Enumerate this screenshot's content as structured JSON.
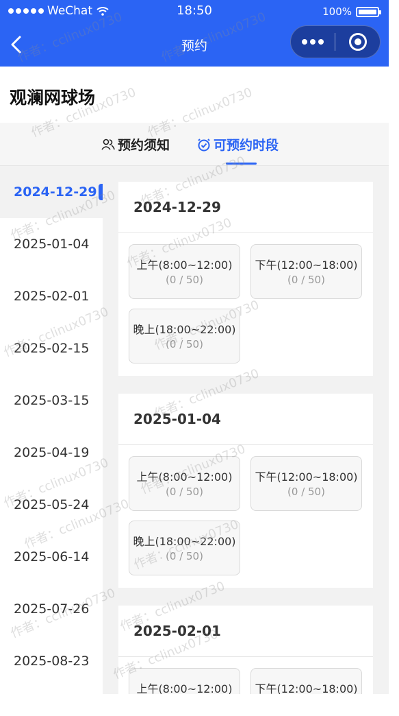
{
  "status": {
    "carrier": "WeChat",
    "time": "18:50",
    "battery": "100%"
  },
  "nav": {
    "title": "预约"
  },
  "venue": {
    "name": "观澜网球场"
  },
  "tabs": {
    "notice": "预约须知",
    "slots": "可预约时段"
  },
  "sidebar": {
    "dates": [
      "2024-12-29",
      "2025-01-04",
      "2025-02-01",
      "2025-02-15",
      "2025-03-15",
      "2025-04-19",
      "2025-05-24",
      "2025-06-14",
      "2025-07-26",
      "2025-08-23"
    ],
    "active_index": 0
  },
  "cards": [
    {
      "date": "2024-12-29",
      "slots": [
        {
          "name": "上午(8:00~12:00)",
          "count": "(0 / 50)"
        },
        {
          "name": "下午(12:00~18:00)",
          "count": "(0 / 50)"
        },
        {
          "name": "晚上(18:00~22:00)",
          "count": "(0 / 50)"
        }
      ]
    },
    {
      "date": "2025-01-04",
      "slots": [
        {
          "name": "上午(8:00~12:00)",
          "count": "(0 / 50)"
        },
        {
          "name": "下午(12:00~18:00)",
          "count": "(0 / 50)"
        },
        {
          "name": "晚上(18:00~22:00)",
          "count": "(0 / 50)"
        }
      ]
    },
    {
      "date": "2025-02-01",
      "slots": [
        {
          "name": "上午(8:00~12:00)",
          "count": ""
        },
        {
          "name": "下午(12:00~18:00)",
          "count": ""
        }
      ]
    }
  ],
  "watermark": "作者：cclinux0730",
  "colors": {
    "primary": "#2b64f4",
    "page_bg": "#f2f2f2"
  }
}
